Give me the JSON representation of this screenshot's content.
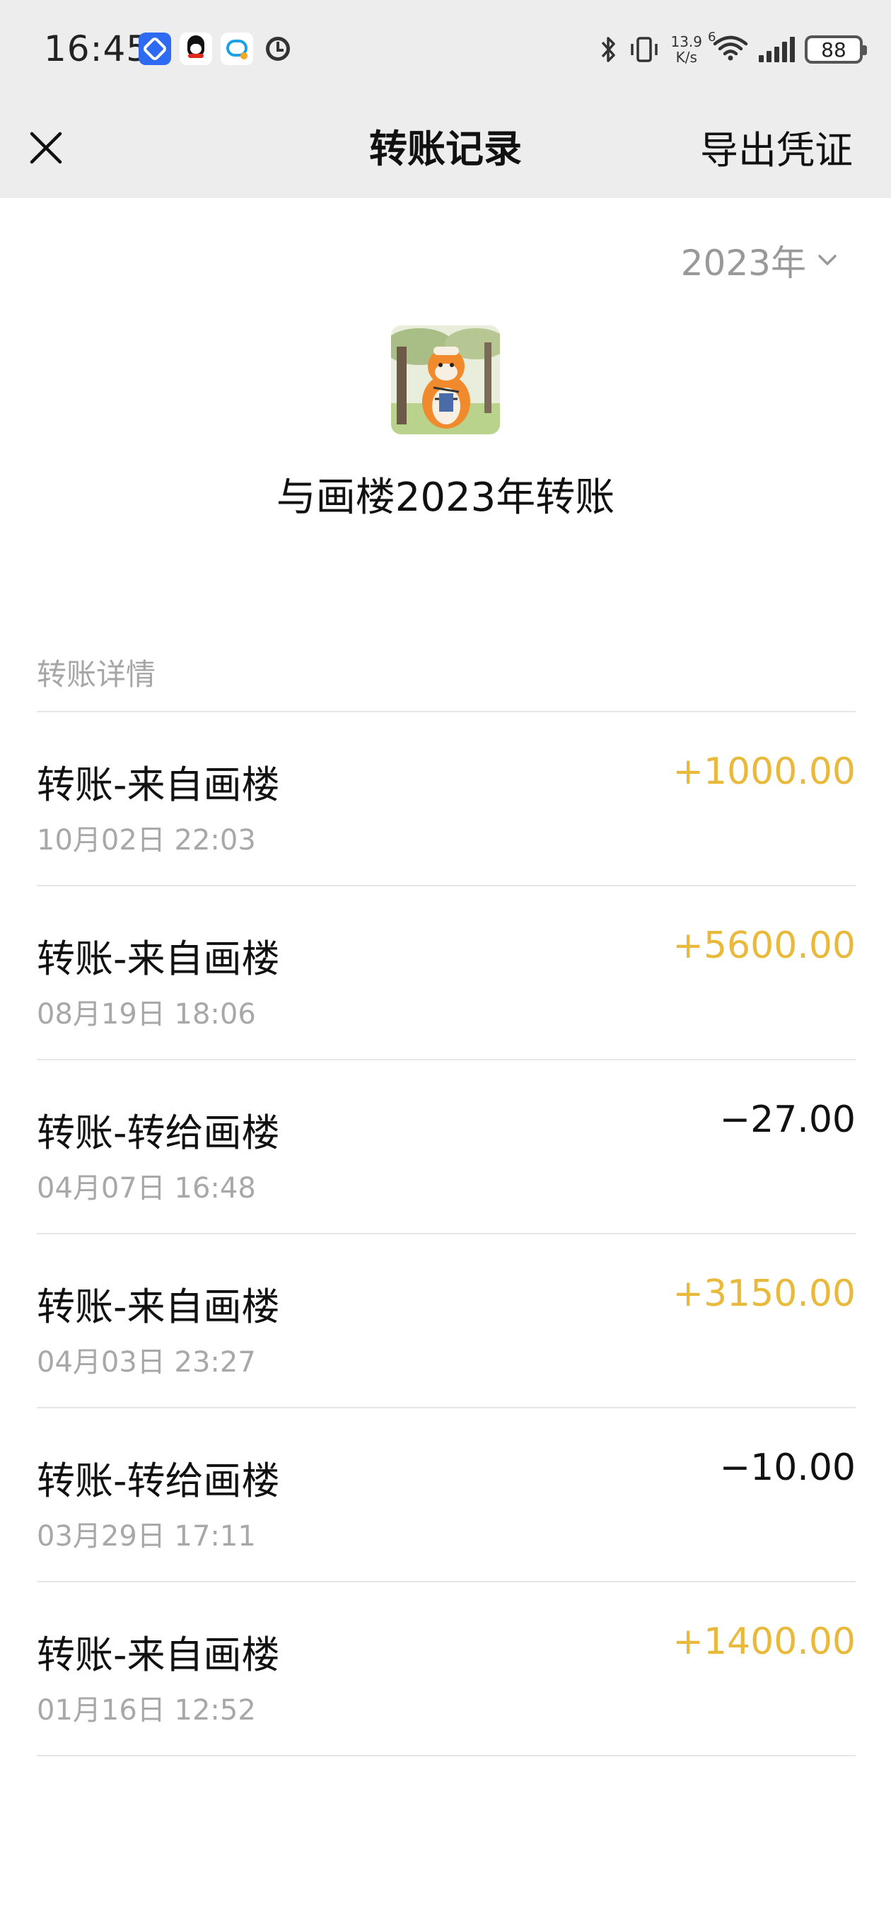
{
  "status_bar": {
    "time": "16:45",
    "net_speed_value": "13.9",
    "net_speed_unit": "K/s",
    "network_type": "6",
    "battery": "88"
  },
  "nav": {
    "title": "转账记录",
    "export_label": "导出凭证"
  },
  "filter": {
    "year": "2023年"
  },
  "summary": {
    "title": "与画楼2023年转账"
  },
  "section": {
    "label": "转账详情"
  },
  "transactions": [
    {
      "title": "转账-来自画楼",
      "time": "10月02日 22:03",
      "amount": "+1000.00",
      "type": "income"
    },
    {
      "title": "转账-来自画楼",
      "time": "08月19日 18:06",
      "amount": "+5600.00",
      "type": "income"
    },
    {
      "title": "转账-转给画楼",
      "time": "04月07日 16:48",
      "amount": "−27.00",
      "type": "expense"
    },
    {
      "title": "转账-来自画楼",
      "time": "04月03日 23:27",
      "amount": "+3150.00",
      "type": "income"
    },
    {
      "title": "转账-转给画楼",
      "time": "03月29日 17:11",
      "amount": "−10.00",
      "type": "expense"
    },
    {
      "title": "转账-来自画楼",
      "time": "01月16日 12:52",
      "amount": "+1400.00",
      "type": "income"
    }
  ],
  "colors": {
    "income": "#e8b93a",
    "expense": "#111111",
    "header_bg": "#ededed"
  }
}
